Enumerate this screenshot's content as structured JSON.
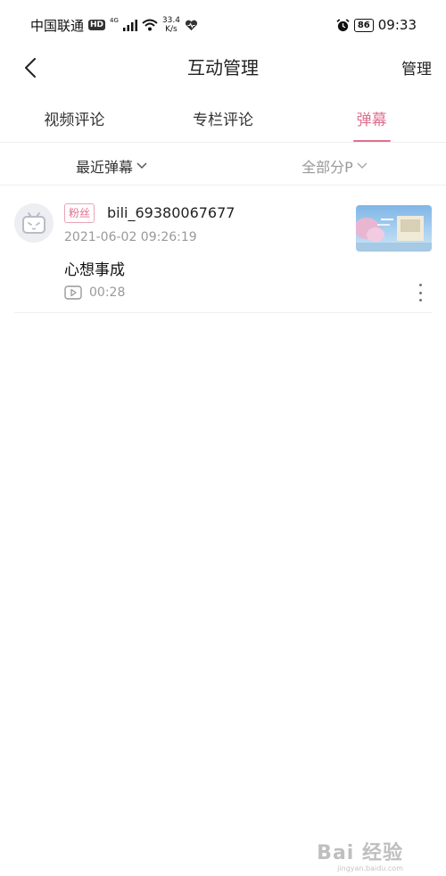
{
  "status_bar": {
    "carrier": "中国联通",
    "hd_badge": "HD",
    "network_gen": "4G",
    "speed_value": "33.4",
    "speed_unit": "K/s",
    "battery": "86",
    "time": "09:33"
  },
  "nav": {
    "back_icon": "chevron-left-icon",
    "title": "互动管理",
    "manage_label": "管理"
  },
  "tabs": [
    {
      "label": "视频评论",
      "active": false
    },
    {
      "label": "专栏评论",
      "active": false
    },
    {
      "label": "弹幕",
      "active": true
    }
  ],
  "filters": {
    "sort_label": "最近弹幕",
    "part_label": "全部分P"
  },
  "danmaku_items": [
    {
      "badge": "粉丝",
      "username": "bili_69380067677",
      "timestamp": "2021-06-02 09:26:19",
      "content": "心想事成",
      "video_time": "00:28"
    }
  ],
  "watermark": {
    "text": "Bai 经验",
    "sub": "jingyan.baidu.com"
  },
  "colors": {
    "accent": "#e0708f",
    "muted": "#999999",
    "divider": "#eeeeee"
  }
}
